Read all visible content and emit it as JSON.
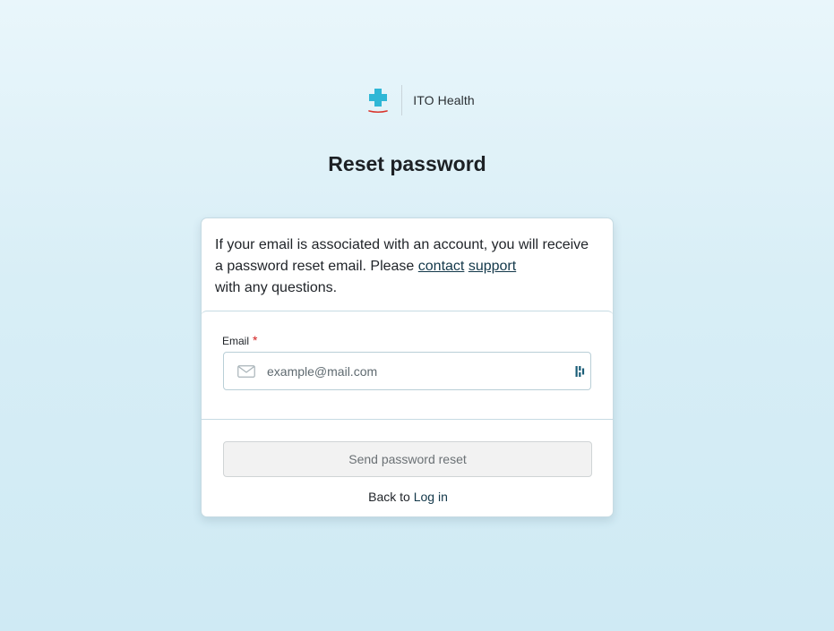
{
  "brand": {
    "name": "ITO Health",
    "logo_icon": "medical-cross-icon",
    "logo_color": "#2fb7d6",
    "logo_underline_color": "#d9342b"
  },
  "page": {
    "title": "Reset password"
  },
  "info": {
    "text_before": "If your email is associated with an account, you will receive a password reset email. Please ",
    "link_contact": "contact",
    "link_support": "support",
    "text_after": "with any questions."
  },
  "form": {
    "email_label": "Email",
    "required_marker": "*",
    "email_value": "",
    "email_placeholder": "example@mail.com",
    "email_icon": "mail-icon",
    "autofill_icon": "password-manager-icon"
  },
  "actions": {
    "submit_label": "Send password reset",
    "back_prefix": "Back to",
    "login_label": "Log in"
  },
  "colors": {
    "link": "#13384a",
    "required": "#d21f1f",
    "background_top": "#e9f6fb",
    "background_bottom": "#cfeaf4"
  }
}
